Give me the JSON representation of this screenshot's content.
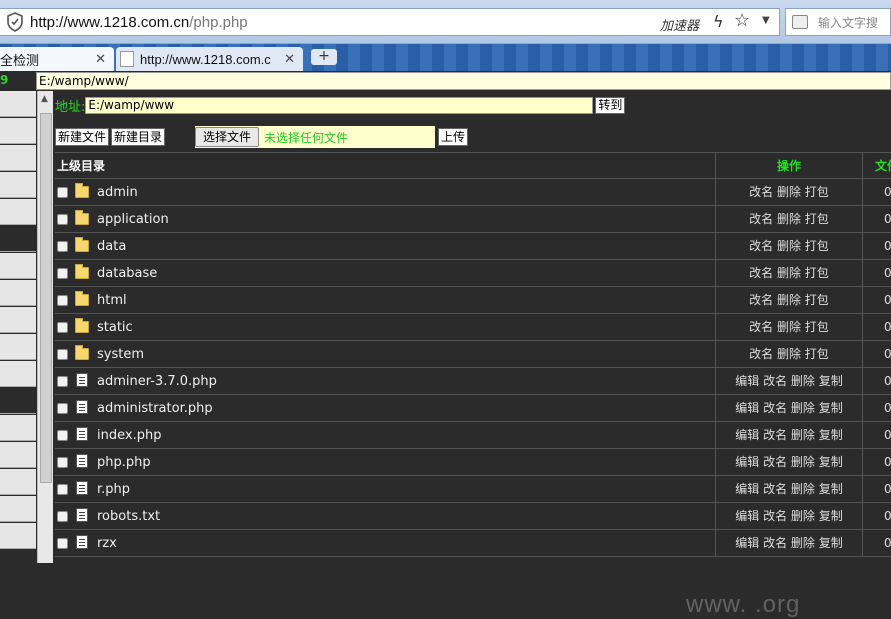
{
  "browser": {
    "url_host": "http://www.1218.com.cn",
    "url_path": "/php.php",
    "accelerate_label": "加速器",
    "search_placeholder": "输入文字搜",
    "tabs": [
      {
        "label": "全检测"
      },
      {
        "label": "http://www.1218.com.c"
      }
    ],
    "new_tab_label": "+"
  },
  "page": {
    "left_number": "9",
    "top_path": "E:/wamp/www/",
    "address_label": "地址:",
    "address_value": "E:/wamp/www",
    "go_label": "转到",
    "new_file_label": "新建文件",
    "new_dir_label": "新建目录",
    "choose_file_label": "选择文件",
    "no_file_label": "未选择任何文件",
    "upload_label": "上传",
    "table": {
      "headers": {
        "name": "上级目录",
        "ops": "操作",
        "col3": "文件"
      },
      "rows": [
        {
          "type": "folder",
          "name": "admin",
          "ops": "改名 删除 打包",
          "col3": "0"
        },
        {
          "type": "folder",
          "name": "application",
          "ops": "改名 删除 打包",
          "col3": "0"
        },
        {
          "type": "folder",
          "name": "data",
          "ops": "改名 删除 打包",
          "col3": "0"
        },
        {
          "type": "folder",
          "name": "database",
          "ops": "改名 删除 打包",
          "col3": "0"
        },
        {
          "type": "folder",
          "name": "html",
          "ops": "改名 删除 打包",
          "col3": "0"
        },
        {
          "type": "folder",
          "name": "static",
          "ops": "改名 删除 打包",
          "col3": "0"
        },
        {
          "type": "folder",
          "name": "system",
          "ops": "改名 删除 打包",
          "col3": "0"
        },
        {
          "type": "file",
          "name": "adminer-3.7.0.php",
          "ops": "编辑 改名 删除 复制",
          "col3": "0"
        },
        {
          "type": "file",
          "name": "administrator.php",
          "ops": "编辑 改名 删除 复制",
          "col3": "0"
        },
        {
          "type": "file",
          "name": "index.php",
          "ops": "编辑 改名 删除 复制",
          "col3": "0"
        },
        {
          "type": "file",
          "name": "php.php",
          "ops": "编辑 改名 删除 复制",
          "col3": "0"
        },
        {
          "type": "file",
          "name": "r.php",
          "ops": "编辑 改名 删除 复制",
          "col3": "0"
        },
        {
          "type": "file",
          "name": "robots.txt",
          "ops": "编辑 改名 删除 复制",
          "col3": "0"
        },
        {
          "type": "file",
          "name": "rzx",
          "ops": "编辑 改名 删除 复制",
          "col3": "0"
        }
      ]
    }
  },
  "watermark": "www.     .org"
}
